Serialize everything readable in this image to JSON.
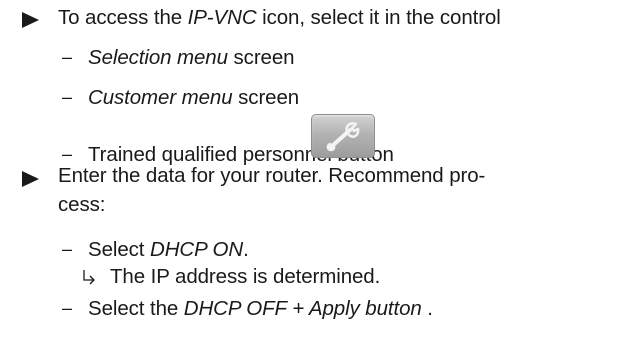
{
  "section1": {
    "intro_prefix": "To access the ",
    "intro_italic": "IP-VNC",
    "intro_suffix": " icon, select it in the control",
    "items": [
      {
        "italic": "Selection menu",
        "rest": " screen"
      },
      {
        "italic": "Customer menu",
        "rest": " screen"
      }
    ],
    "button_item": "Trained qualified personnel button",
    "button_icon": "wrench-icon"
  },
  "section2": {
    "line1": "Enter the data for your router. Recommend pro-",
    "line2": "cess:",
    "step1_prefix": "Select ",
    "step1_italic": "DHCP ON",
    "step1_suffix": ".",
    "result": "The IP address is determined.",
    "step2_prefix": "Select the ",
    "step2_italic": "DHCP OFF + Apply button",
    "step2_suffix": " ."
  }
}
